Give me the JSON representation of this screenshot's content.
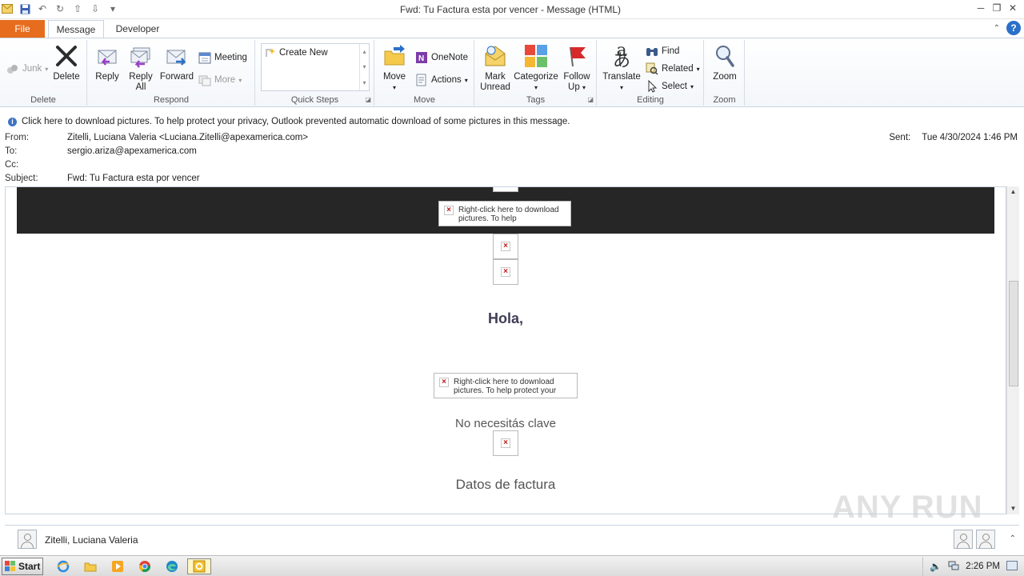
{
  "window": {
    "title": "Fwd: Tu Factura esta por vencer  -  Message (HTML)"
  },
  "tabs": {
    "file": "File",
    "message": "Message",
    "developer": "Developer"
  },
  "ribbon": {
    "delete_group": {
      "label": "Delete",
      "junk": "Junk",
      "delete": "Delete"
    },
    "respond_group": {
      "label": "Respond",
      "reply": "Reply",
      "reply_all_1": "Reply",
      "reply_all_2": "All",
      "forward": "Forward",
      "meeting": "Meeting",
      "more": "More"
    },
    "quick_steps_group": {
      "label": "Quick Steps",
      "create_new": "Create New"
    },
    "move_group": {
      "label": "Move",
      "move": "Move",
      "onenote": "OneNote",
      "actions": "Actions"
    },
    "tags_group": {
      "label": "Tags",
      "mark_unread_1": "Mark",
      "mark_unread_2": "Unread",
      "categorize": "Categorize",
      "follow_up_1": "Follow",
      "follow_up_2": "Up"
    },
    "editing_group": {
      "label": "Editing",
      "translate": "Translate",
      "find": "Find",
      "related": "Related",
      "select": "Select"
    },
    "zoom_group": {
      "label": "Zoom",
      "zoom": "Zoom"
    }
  },
  "infobar": {
    "text": "Click here to download pictures. To help protect your privacy, Outlook prevented automatic download of some pictures in this message."
  },
  "header": {
    "from_label": "From:",
    "from_value": "Zitelli, Luciana Valeria <Luciana.Zitelli@apexamerica.com>",
    "to_label": "To:",
    "to_value": "sergio.ariza@apexamerica.com",
    "cc_label": "Cc:",
    "subject_label": "Subject:",
    "subject_value": "Fwd: Tu Factura esta por vencer",
    "sent_label": "Sent:",
    "sent_value": "Tue 4/30/2024 1:46 PM"
  },
  "body": {
    "blocked_image_text_1": "Right-click here to download pictures. To help",
    "blocked_image_text_2": "Right-click here to download pictures. To help protect your",
    "greeting": "Hola,",
    "no_key": "No necesitás clave",
    "invoice_data": "Datos de factura"
  },
  "watermark": "ANY RUN",
  "people_pane": {
    "name": "Zitelli, Luciana Valeria"
  },
  "taskbar": {
    "start": "Start",
    "clock": "2:26 PM"
  },
  "colors": {
    "file_tab": "#e66c1e",
    "dark_band": "#262626",
    "greeting": "#3f3d56"
  }
}
